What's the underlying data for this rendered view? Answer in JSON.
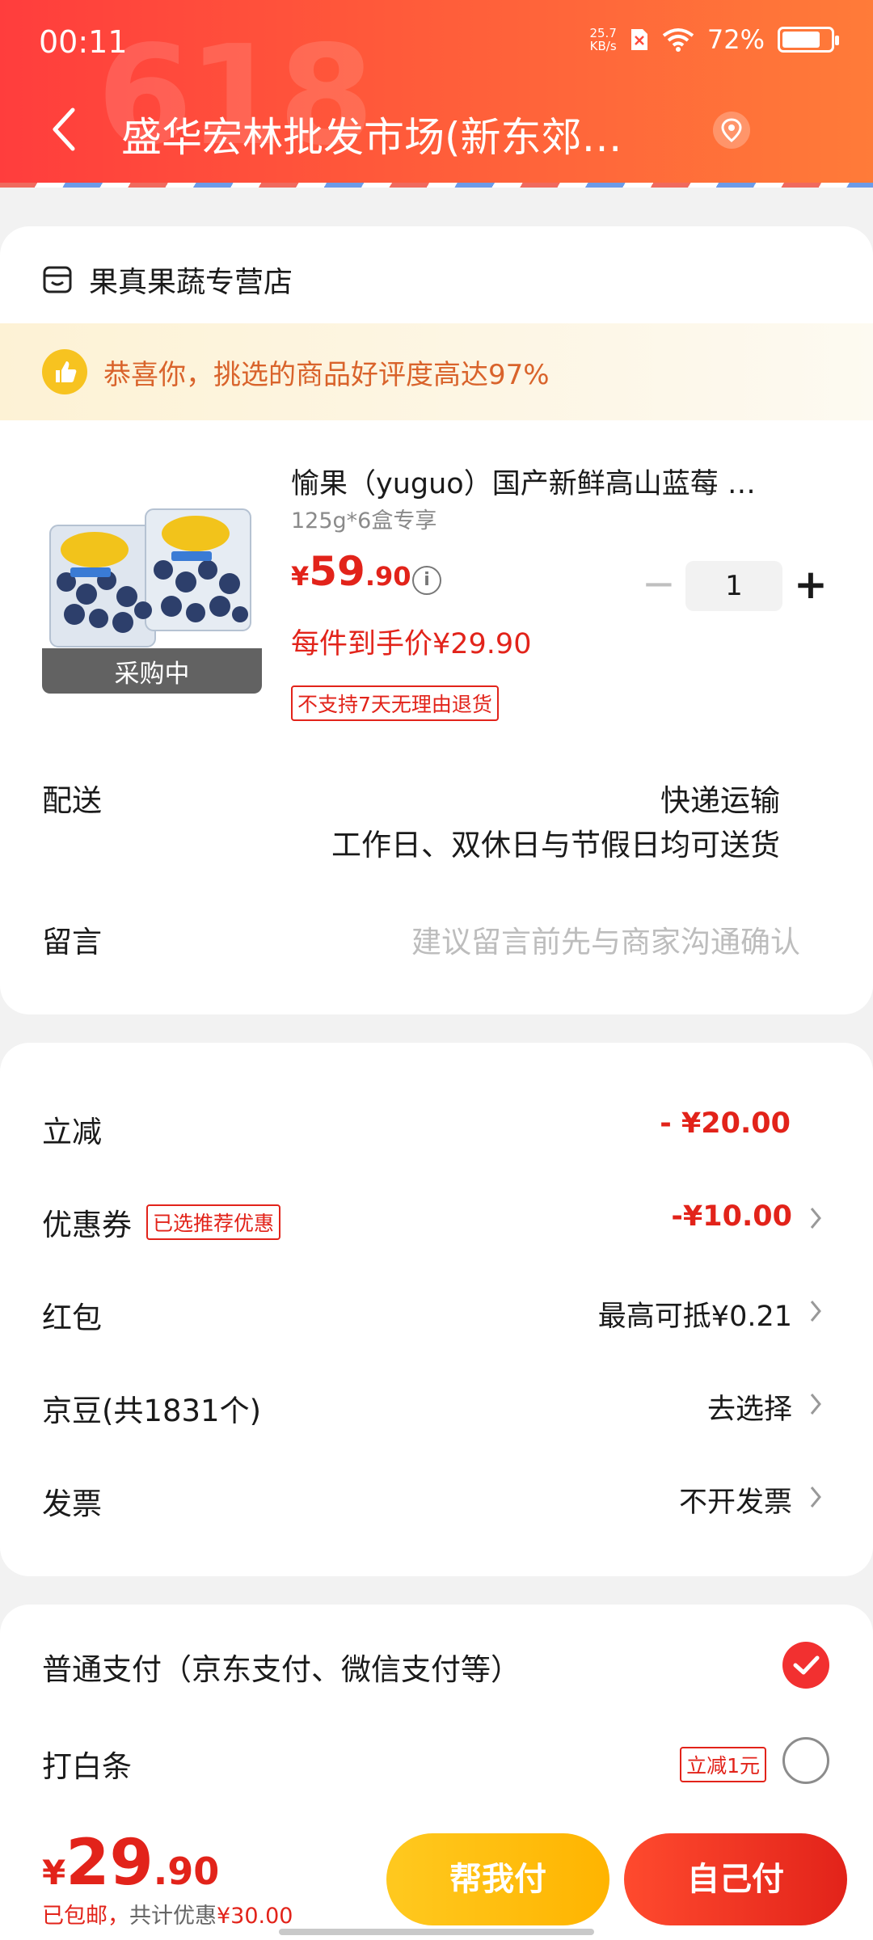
{
  "status_bar": {
    "time": "00:11",
    "net_speed_value": "25.7",
    "net_speed_unit": "KB/s",
    "battery": "72%",
    "battery_level": 0.72
  },
  "header": {
    "watermark": "618",
    "title": "盛华宏林批发市场(新东郊…"
  },
  "store": {
    "name": "果真果蔬专营店"
  },
  "banner": {
    "text": "恭喜你，挑选的商品好评度高达97%"
  },
  "product": {
    "title": "愉果（yuguo）国产新鲜高山蓝莓 …",
    "spec": "125g*6盒专享",
    "price_yen": "¥",
    "price_int": "59",
    "price_dec": ".90",
    "final_price": "每件到手价¥29.90",
    "no_return": "不支持7天无理由退货",
    "status": "采购中",
    "quantity": "1"
  },
  "delivery": {
    "label": "配送",
    "method": "快递运输",
    "note": "工作日、双休日与节假日均可送货"
  },
  "message": {
    "label": "留言",
    "placeholder": "建议留言前先与商家沟通确认"
  },
  "discounts": {
    "instant_label": "立减",
    "instant_value": "- ¥20.00",
    "coupon_label": "优惠券",
    "coupon_tag": "已选推荐优惠",
    "coupon_value": "-¥10.00",
    "redpacket_label": "红包",
    "redpacket_value": "最高可抵¥0.21",
    "jingdou_label": "京豆(共1831个)",
    "jingdou_value": "去选择",
    "invoice_label": "发票",
    "invoice_value": "不开发票"
  },
  "payment": {
    "normal_label": "普通支付（京东支付、微信支付等）",
    "baitiao_label": "打白条",
    "baitiao_tag": "立减1元"
  },
  "footer": {
    "total_yen": "¥",
    "total_int": "29",
    "total_dec": ".90",
    "shipping": "已包邮，",
    "saving_label": "共计优惠",
    "saving_value": "¥30.00",
    "help_pay": "帮我付",
    "self_pay": "自己付"
  },
  "colors": {
    "accent_red": "#e2231a",
    "header_gradient": [
      "#ff3d3d",
      "#ff7b39"
    ],
    "help_button": "#ffc91f"
  }
}
